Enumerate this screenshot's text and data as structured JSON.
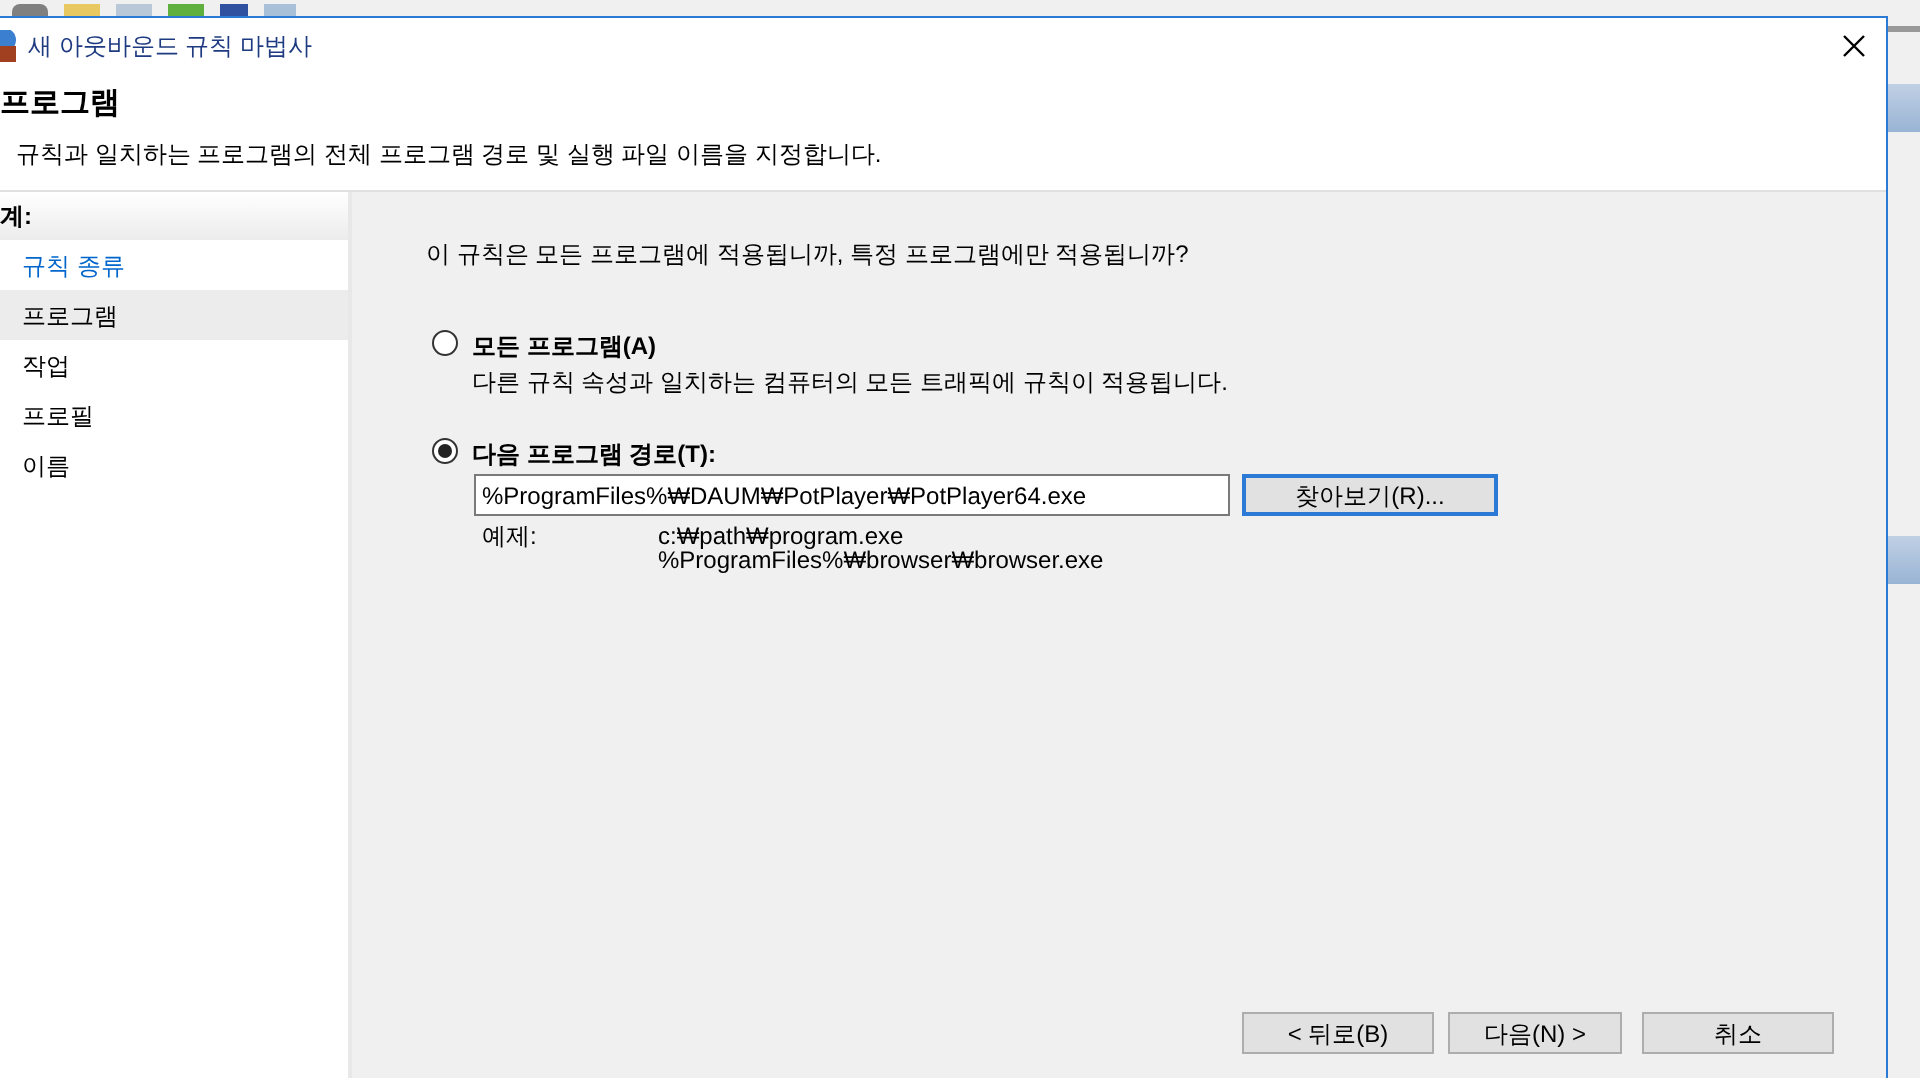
{
  "window": {
    "title": "새 아웃바운드 규칙 마법사"
  },
  "header": {
    "title": "프로그램",
    "description": "규칙과 일치하는 프로그램의 전체 프로그램 경로 및 실행 파일 이름을 지정합니다."
  },
  "steps": {
    "heading": "계:",
    "items": [
      {
        "label": "규칙 종류",
        "selected": false,
        "done": true
      },
      {
        "label": "프로그램",
        "selected": true,
        "done": false
      },
      {
        "label": "작업",
        "selected": false,
        "done": false
      },
      {
        "label": "프로필",
        "selected": false,
        "done": false
      },
      {
        "label": "이름",
        "selected": false,
        "done": false
      }
    ]
  },
  "question": "이 규칙은 모든 프로그램에 적용됩니까, 특정 프로그램에만 적용됩니까?",
  "options": [
    {
      "label": "모든 프로그램(A)",
      "description": "다른 규칙 속성과 일치하는 컴퓨터의 모든 트래픽에 규칙이 적용됩니다.",
      "selected": false
    },
    {
      "label": "다음 프로그램 경로(T):",
      "selected": true
    }
  ],
  "path": {
    "value": "%ProgramFiles%₩DAUM₩PotPlayer₩PotPlayer64.exe",
    "browse": "찾아보기(R)...",
    "example_label": "예제:",
    "examples": [
      "c:₩path₩program.exe",
      "%ProgramFiles%₩browser₩browser.exe"
    ]
  },
  "buttons": [
    "< 뒤로(B)",
    "다음(N) >",
    "취소"
  ]
}
